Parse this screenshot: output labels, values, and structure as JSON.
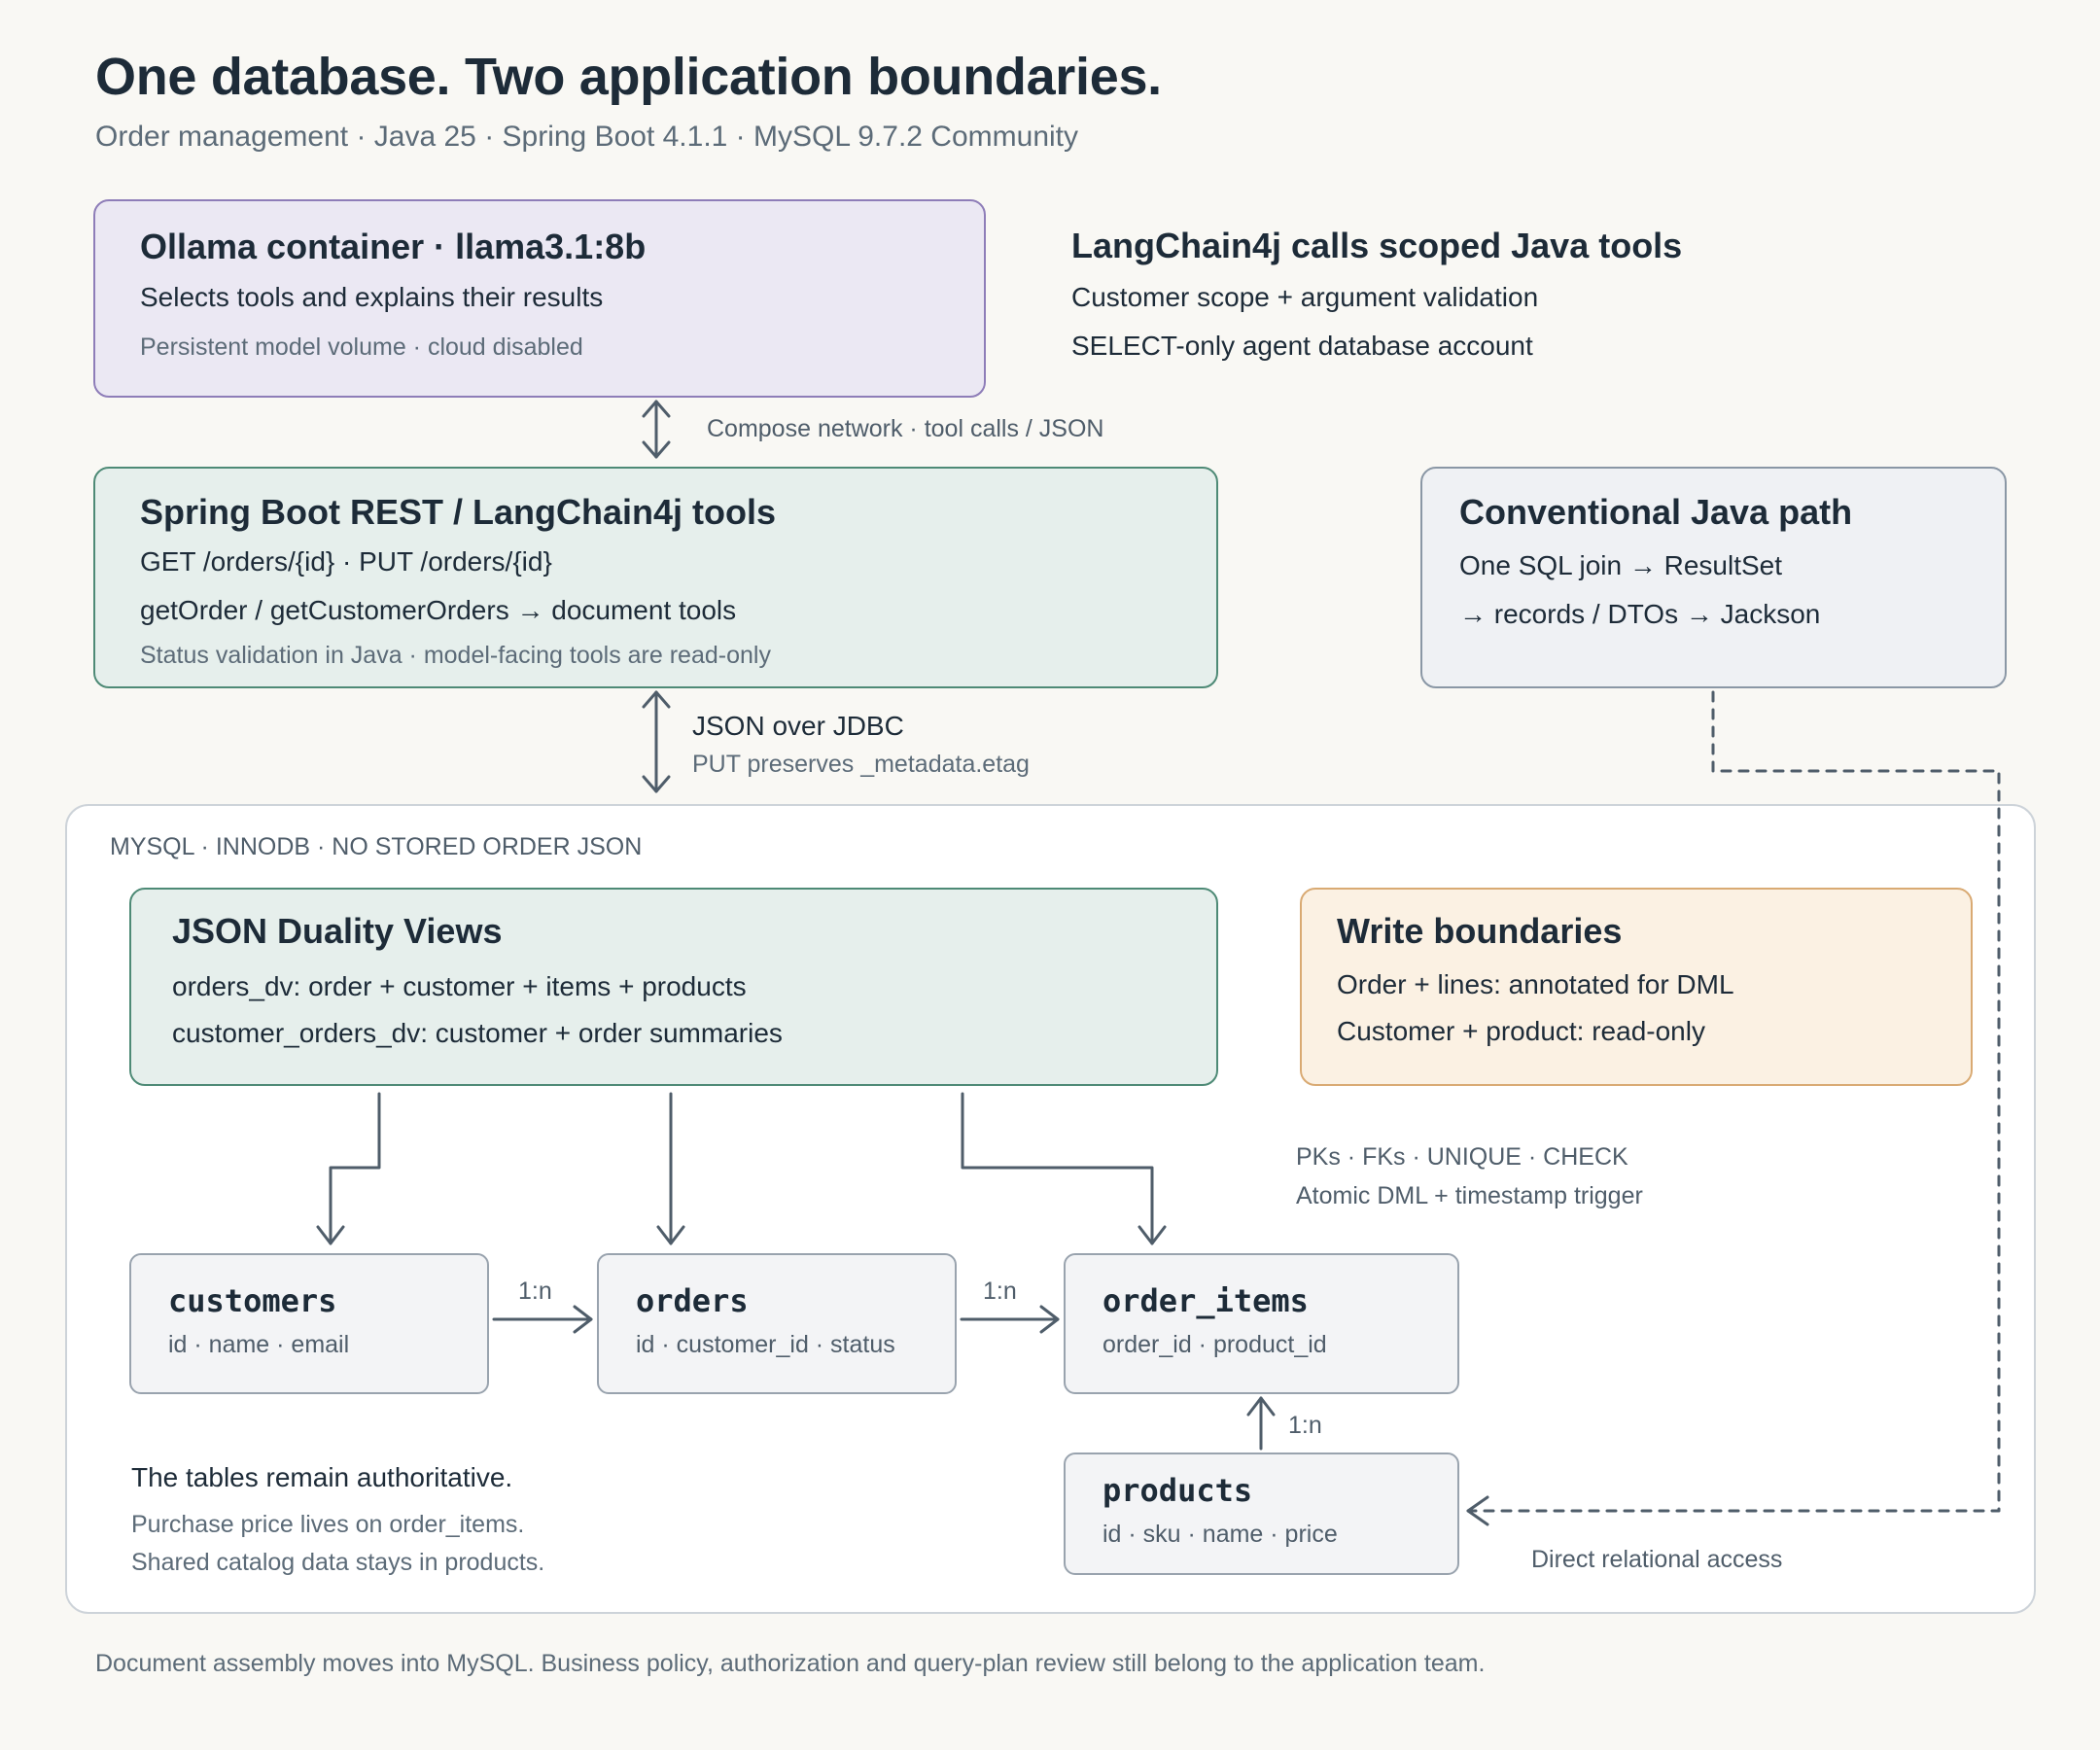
{
  "header": {
    "title": "One database. Two application boundaries.",
    "subtitle": "Order management · Java 25 · Spring Boot 4.1.1 · MySQL 9.7.2 Community"
  },
  "ollama": {
    "title": "Ollama container · llama3.1:8b",
    "line1": "Selects tools and explains their results",
    "line2": "Persistent model volume · cloud disabled"
  },
  "langchain_note": {
    "title": "LangChain4j calls scoped Java tools",
    "line1": "Customer scope + argument validation",
    "line2": "SELECT-only agent database account"
  },
  "compose_label": "Compose network · tool calls / JSON",
  "spring": {
    "title": "Spring Boot REST / LangChain4j tools",
    "line1": "GET /orders/{id} · PUT /orders/{id}",
    "line2": "getOrder / getCustomerOrders → document tools",
    "line3": "Status validation in Java · model-facing tools are read-only"
  },
  "conventional": {
    "title": "Conventional Java path",
    "line1": "One SQL join → ResultSet",
    "line2": "→ records / DTOs → Jackson"
  },
  "jdbc_label": {
    "main": "JSON over JDBC",
    "sub": "PUT preserves _metadata.etag"
  },
  "database": {
    "caption": "MYSQL · INNODB · NO STORED ORDER JSON",
    "duality": {
      "title": "JSON Duality Views",
      "line1": "orders_dv: order + customer + items + products",
      "line2": "customer_orders_dv: customer + order summaries"
    },
    "write": {
      "title": "Write boundaries",
      "line1": "Order + lines: annotated for DML",
      "line2": "Customer + product: read-only"
    },
    "constraints": {
      "line1": "PKs · FKs · UNIQUE · CHECK",
      "line2": "Atomic DML + timestamp trigger"
    },
    "tables": [
      {
        "name": "customers",
        "cols": "id · name · email"
      },
      {
        "name": "orders",
        "cols": "id · customer_id · status"
      },
      {
        "name": "order_items",
        "cols": "order_id · product_id"
      },
      {
        "name": "products",
        "cols": "id · sku · name · price"
      }
    ],
    "rel_labels": [
      "1:n",
      "1:n",
      "1:n"
    ],
    "authoritative": {
      "title": "The tables remain authoritative.",
      "line1": "Purchase price lives on order_items.",
      "line2": "Shared catalog data stays in products."
    },
    "direct_label": "Direct relational access"
  },
  "footer": "Document assembly moves into MySQL. Business policy, authorization and query-plan review still belong to the application team.",
  "colors": {
    "arrow": "#4f5d6a",
    "purple": "#8e7db8",
    "green": "#4e8a76",
    "orange": "#d9aa73"
  }
}
